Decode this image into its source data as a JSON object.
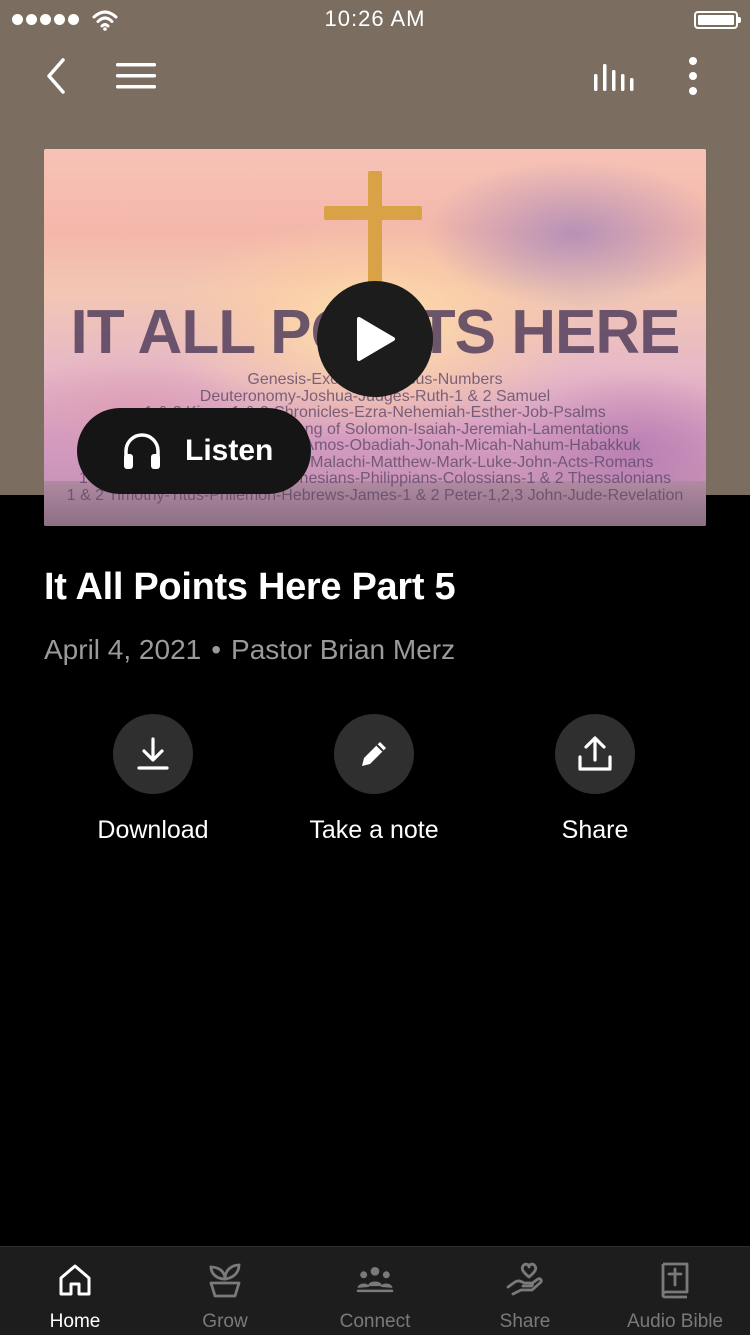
{
  "status_bar": {
    "time": "10:26 AM"
  },
  "nav": {
    "back_icon": "chevron-left-icon",
    "menu_icon": "hamburger-menu-icon",
    "audio_icon": "audio-levels-icon",
    "more_icon": "more-vertical-icon"
  },
  "hero": {
    "title": "IT ALL POINTS HERE",
    "books": [
      "Genesis-Exodus-Leviticus-Numbers",
      "Deuteronomy-Joshua-Judges-Ruth-1 & 2 Samuel",
      "1 & 2 Kings-1 & 2 Chronicles-Ezra-Nehemiah-Esther-Job-Psalms",
      "Proverbs-Ecclesiastes-Song of Solomon-Isaiah-Jeremiah-Lamentations",
      "Ezekiel-Daniel-Hosea-Joel-Amos-Obadiah-Jonah-Micah-Nahum-Habakkuk",
      "Zephaniah-Haggai-Zechariah-Malachi-Matthew-Mark-Luke-John-Acts-Romans",
      "1 & 2 Corinthians-Galatians-Ephesians-Philippians-Colossians-1 & 2 Thessalonians",
      "1 & 2 Timothy-Titus-Philemon-Hebrews-James-1 & 2 Peter-1,2,3 John-Jude-Revelation"
    ],
    "listen_label": "Listen"
  },
  "sermon": {
    "title": "It All Points Here Part 5",
    "date": "April 4, 2021",
    "separator": "•",
    "speaker": "Pastor Brian Merz"
  },
  "actions": {
    "download_label": "Download",
    "note_label": "Take a note",
    "share_label": "Share"
  },
  "tabs": [
    {
      "label": "Home",
      "icon": "home-icon",
      "active": true
    },
    {
      "label": "Grow",
      "icon": "sprout-icon",
      "active": false
    },
    {
      "label": "Connect",
      "icon": "people-icon",
      "active": false
    },
    {
      "label": "Share",
      "icon": "heart-hand-icon",
      "active": false
    },
    {
      "label": "Audio Bible",
      "icon": "bible-icon",
      "active": false
    }
  ],
  "colors": {
    "header_bg": "#7b6e60",
    "page_bg": "#000000",
    "tab_bar_bg": "#1d1d1d",
    "button_circle": "#2f2f2f",
    "inactive_tab": "#7a7a7a",
    "meta_text": "#9a9a9a"
  }
}
